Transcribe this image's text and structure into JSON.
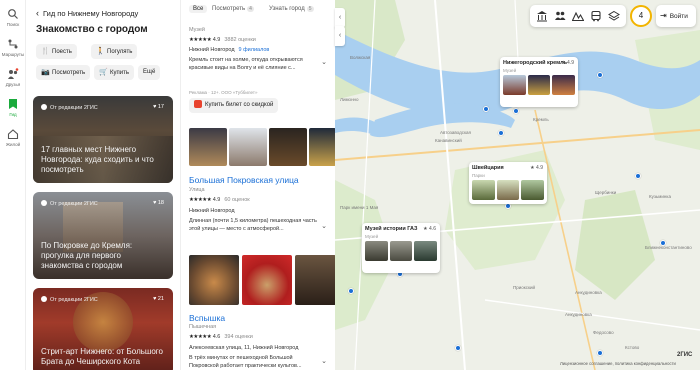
{
  "rail": {
    "items": [
      {
        "label": "Поиск",
        "icon": "search-icon"
      },
      {
        "label": "Маршруты",
        "icon": "route-icon"
      },
      {
        "label": "Друзья",
        "icon": "friends-icon"
      },
      {
        "label": "Гид",
        "icon": "guide-icon"
      },
      {
        "label": "Жилой",
        "icon": "home-icon"
      }
    ],
    "accent": "#1aaa3c"
  },
  "panel": {
    "back_label": "Гид по Нижнему Новгороду",
    "title": "Знакомство с городом",
    "chips": [
      {
        "label": "Поесть",
        "icon": "fork-icon"
      },
      {
        "label": "Погулять",
        "icon": "walk-icon"
      },
      {
        "label": "Посмотреть",
        "icon": "camera-icon"
      },
      {
        "label": "Купить",
        "icon": "cart-icon"
      },
      {
        "label": "Ещё",
        "icon": ""
      }
    ],
    "cards": [
      {
        "source": "От редакции 2ГИС",
        "likes": "17",
        "title": "17 главных мест Нижнего Новгорода: куда сходить и что посмотреть"
      },
      {
        "source": "От редакции 2ГИС",
        "likes": "18",
        "title": "По Покровке до Кремля: прогулка для первого знакомства с городом"
      },
      {
        "source": "От редакции 2ГИС",
        "likes": "21",
        "title": "Стрит-арт Нижнего: от Большого Брата до Чеширского Кота"
      }
    ]
  },
  "results": {
    "tabs": [
      {
        "label": "Все",
        "count": ""
      },
      {
        "label": "Посмотреть",
        "count": "4"
      },
      {
        "label": "Узнать город",
        "count": "5"
      }
    ],
    "item1": {
      "category": "Музей",
      "stars": "★★★★★",
      "rating": "4.9",
      "reviews": "3882 оценки",
      "address": "Нижний Новгород",
      "branches": "9 филиалов",
      "desc": "Кремль стоит на холме, откуда открываются красивые виды на Волгу и её слияние с..."
    },
    "ad_note": "Реклама · 12+. ООО «Туббилет»",
    "ticket_label": "Купить билет со скидкой",
    "item2": {
      "title": "Большая Покровская улица",
      "category": "Улица",
      "stars": "★★★★★",
      "rating": "4.9",
      "reviews": "60 оценок",
      "address": "Нижний Новгород",
      "desc": "Длинная (почти 1,5 километра) пешеходная часть этой улицы — место с атмосферой..."
    },
    "item3": {
      "title": "Вспышка",
      "category": "Пышечная",
      "stars": "★★★★★",
      "rating": "4.6",
      "reviews": "394 оценки",
      "address": "Алексеевская улица, 11, Нижний Новгород",
      "desc": "В трёх минутах от пешеходной Большой Покровской работает практически культов..."
    }
  },
  "map": {
    "notifications": "4",
    "login_label": "Войти",
    "popups": [
      {
        "title": "Нижегородский кремль",
        "rating": "★ 4.9",
        "category": "Музей"
      },
      {
        "title": "Швейцария",
        "rating": "★ 4.9",
        "category": "Парки"
      },
      {
        "title": "Музей истории ГАЗ",
        "rating": "★ 4.6",
        "category": "Музей"
      }
    ],
    "labels": [
      "Лимонно",
      "Волжская",
      "Автозаводская",
      "Канавинский",
      "Кремль",
      "Кузьминка",
      "Парк имени 1 Мая",
      "Щербинки",
      "Ближнеконстантиново",
      "Анкудиновка",
      "Федосово",
      "Приокский",
      "Кстово",
      "Анкудиновка"
    ],
    "brand": "2ГИС",
    "legal": "Лицензионное соглашение, политика конфиденциальности"
  }
}
